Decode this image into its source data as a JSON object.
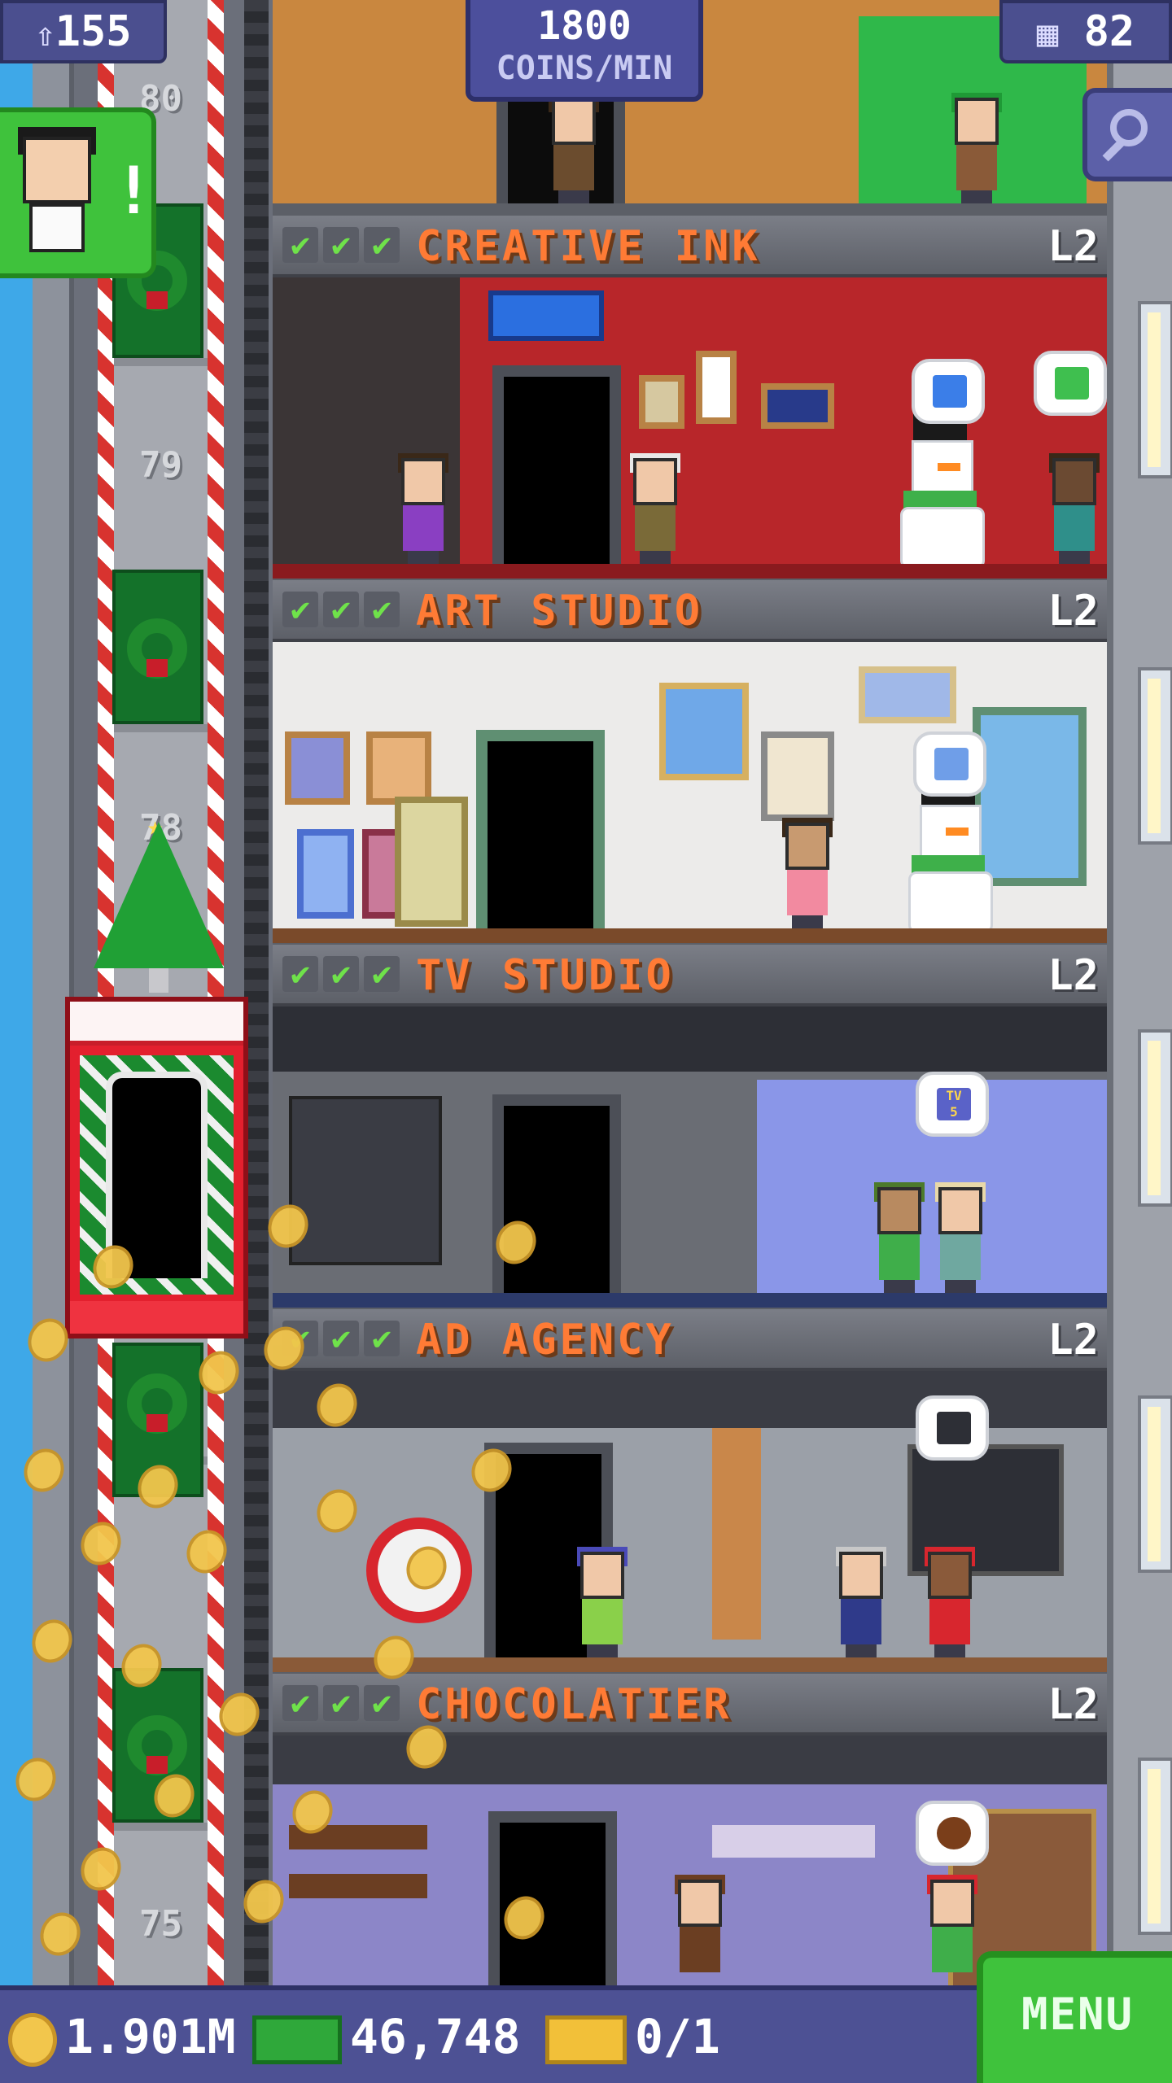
{
  "hud": {
    "population": "155",
    "coins_per_min_value": "1800",
    "coins_per_min_unit": "COINS/MIN",
    "floor_count": "82"
  },
  "elevator": {
    "floor_labels": [
      "80",
      "79",
      "78",
      "75"
    ]
  },
  "floors": [
    {
      "name": "CREATIVE INK",
      "level": "L2",
      "checks": [
        "✔",
        "✔",
        "✔"
      ]
    },
    {
      "name": "ART STUDIO",
      "level": "L2",
      "checks": [
        "✔",
        "✔",
        "✔"
      ]
    },
    {
      "name": "TV STUDIO",
      "level": "L2",
      "checks": [
        "✔",
        "✔",
        "✔"
      ]
    },
    {
      "name": "AD AGENCY",
      "level": "L2",
      "checks": [
        "✔",
        "✔",
        "✔"
      ]
    },
    {
      "name": "CHOCOLATIER",
      "level": "L2",
      "checks": [
        "✔",
        "✔",
        "✔"
      ]
    }
  ],
  "bubbles": {
    "tv_studio_badge": "TV\n5"
  },
  "bottom": {
    "coins": "1.901M",
    "bux": "46,748",
    "tickets": "0/1",
    "menu_label": "MENU"
  },
  "visitor": {
    "alert": "!"
  },
  "colors": {
    "floor_title": "#ff7b35",
    "check": "#6fe24a",
    "hud_panel": "#4b4f8f",
    "menu_button": "#3fc23c"
  },
  "icons": {
    "population": "person-up-icon",
    "floors": "building-icon",
    "search": "magnifier-icon",
    "coin": "coin-icon",
    "bux": "bux-bill-icon",
    "ticket": "golden-ticket-icon"
  }
}
